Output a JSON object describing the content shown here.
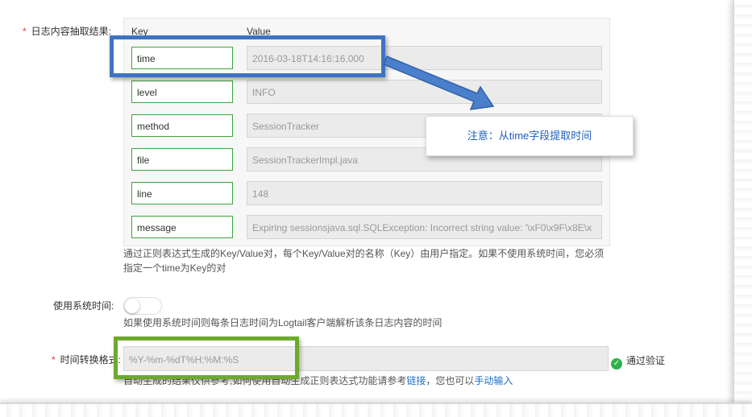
{
  "extraction": {
    "label": "日志内容抽取结果:",
    "key_header": "Key",
    "value_header": "Value",
    "rows": [
      {
        "key": "time",
        "value": "2016-03-18T14:16:16,000"
      },
      {
        "key": "level",
        "value": "INFO"
      },
      {
        "key": "method",
        "value": "SessionTracker"
      },
      {
        "key": "file",
        "value": "SessionTrackerImpl.java"
      },
      {
        "key": "line",
        "value": "148"
      },
      {
        "key": "message",
        "value": "Expiring sessionsjava.sql.SQLException: Incorrect string value: '\\xF0\\x9F\\x8E\\x"
      }
    ],
    "help_line1": "通过正则表达式生成的Key/Value对，每个Key/Value对的名称（Key）由用户指定。如果不使用系统时间，您必须",
    "help_line2": "指定一个time为Key的对"
  },
  "system_time": {
    "label": "使用系统时间:",
    "enabled": false,
    "help": "如果使用系统时间则每条日志时间为Logtail客户端解析该条日志内容的时间"
  },
  "time_format": {
    "label": "时间转换格式:",
    "value": "%Y-%m-%dT%H:%M:%S",
    "status": "通过验证",
    "help_prefix": "自动生成的结果仅供参考,如何使用自动生成正则表达式功能请参考",
    "help_link": "链接",
    "help_middle": "，您也可以",
    "help_link2": "手动输入"
  },
  "annotation": {
    "note": "注意：从time字段提取时间",
    "colors": {
      "blue": "#3d74c2",
      "green": "#6eaa2a",
      "note_text": "#1f5fbf"
    }
  }
}
